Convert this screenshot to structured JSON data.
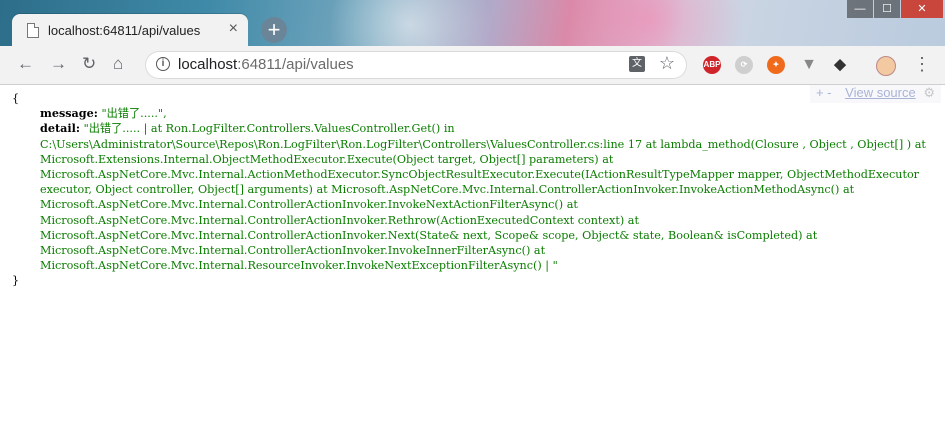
{
  "browser": {
    "tab": {
      "title": "localhost:64811/api/values",
      "close": "×"
    },
    "new_tab": "+",
    "window_controls": {
      "minimize": "—",
      "maximize": "☐",
      "close": "✕"
    },
    "nav": {
      "back": "←",
      "forward": "→",
      "reload": "↻",
      "home": "⌂"
    },
    "address": {
      "host": "localhost",
      "rest": ":64811/api/values"
    },
    "extensions": [
      "ABP",
      "sync",
      "orange-addon",
      "vee",
      "bird",
      "avatar"
    ],
    "menu": "⋮"
  },
  "viewer": {
    "plus_minus": "+ -",
    "view_source": "View source",
    "gear": "⚙"
  },
  "json": {
    "open_brace": "{",
    "close_brace": "}",
    "message_key": "message:",
    "message_value": "\"出错了.....\",",
    "detail_key": "detail:",
    "detail_value": "\"出错了..... | at Ron.LogFilter.Controllers.ValuesController.Get() in C:\\Users\\Administrator\\Source\\Repos\\Ron.LogFilter\\Ron.LogFilter\\Controllers\\ValuesController.cs:line 17 at lambda_method(Closure , Object , Object[] ) at Microsoft.Extensions.Internal.ObjectMethodExecutor.Execute(Object target, Object[] parameters) at Microsoft.AspNetCore.Mvc.Internal.ActionMethodExecutor.SyncObjectResultExecutor.Execute(IActionResultTypeMapper mapper, ObjectMethodExecutor executor, Object controller, Object[] arguments) at Microsoft.AspNetCore.Mvc.Internal.ControllerActionInvoker.InvokeActionMethodAsync() at Microsoft.AspNetCore.Mvc.Internal.ControllerActionInvoker.InvokeNextActionFilterAsync() at Microsoft.AspNetCore.Mvc.Internal.ControllerActionInvoker.Rethrow(ActionExecutedContext context) at Microsoft.AspNetCore.Mvc.Internal.ControllerActionInvoker.Next(State& next, Scope& scope, Object& state, Boolean& isCompleted) at Microsoft.AspNetCore.Mvc.Internal.ControllerActionInvoker.InvokeInnerFilterAsync() at Microsoft.AspNetCore.Mvc.Internal.ResourceInvoker.InvokeNextExceptionFilterAsync() | \""
  },
  "colors": {
    "string": "#0a7d00",
    "key": "#000000",
    "view_source_link": "#aab3d6",
    "close_button": "#c9463d"
  }
}
